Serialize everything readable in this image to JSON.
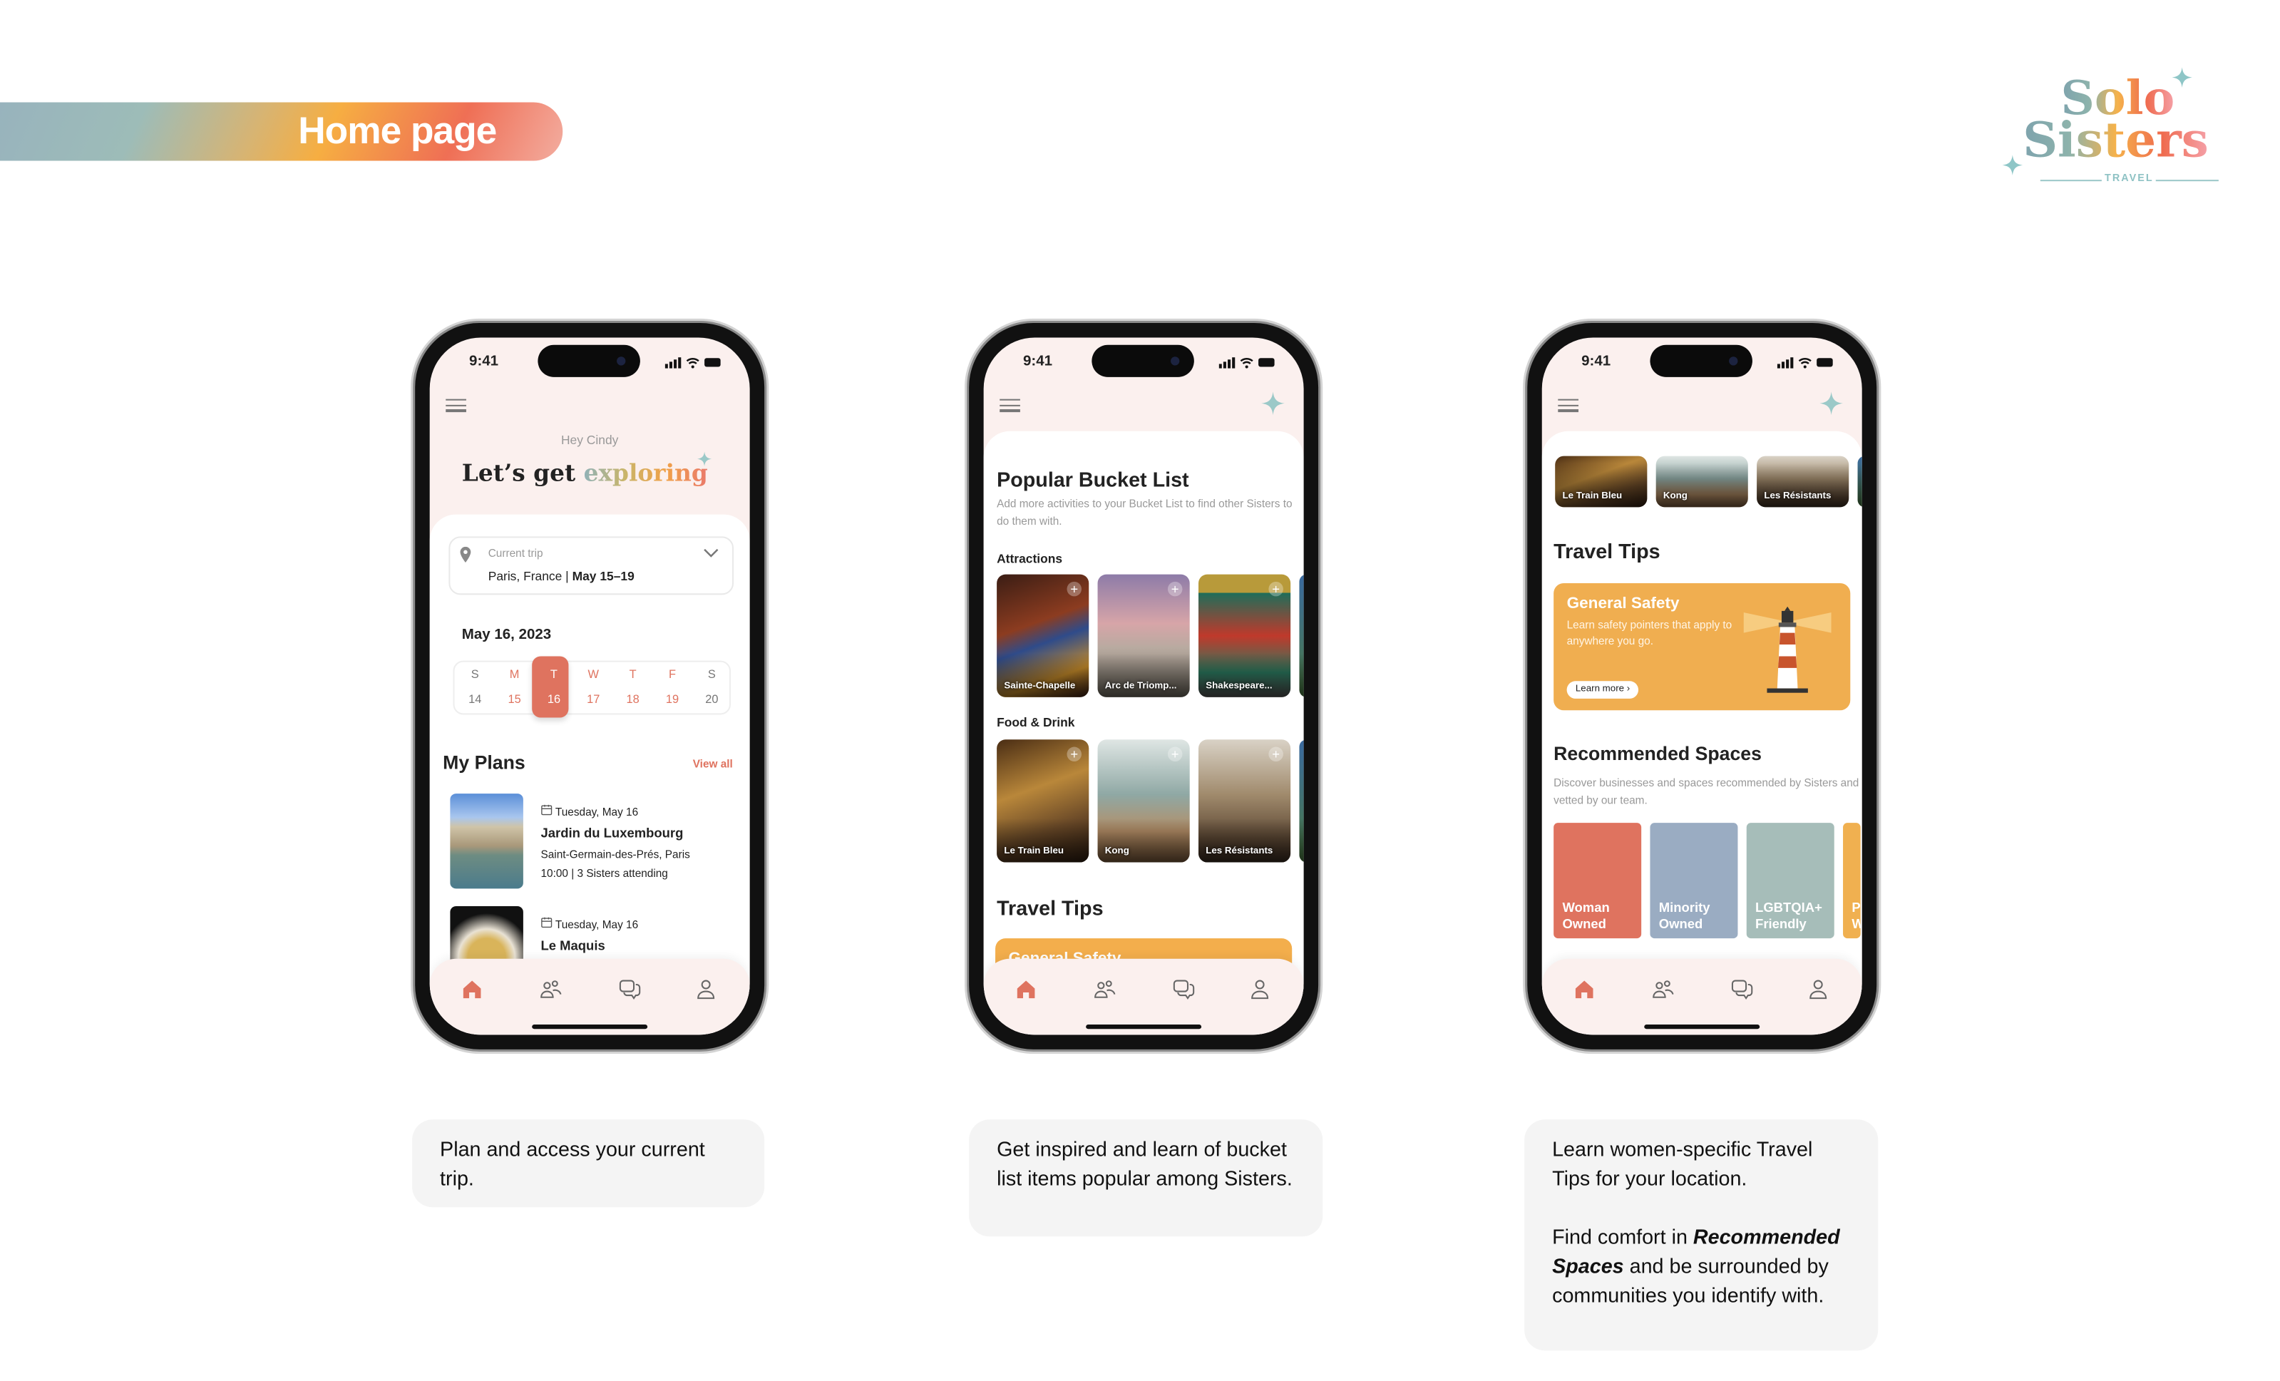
{
  "banner": {
    "title": "Home page"
  },
  "logo": {
    "line1": "Solo",
    "line2": "Sisters",
    "tagline": "TRAVEL"
  },
  "colors": {
    "accent": "#df735f",
    "tip_card": "#f3ae4c",
    "screen_tint": "#fbf0ee",
    "woman_owned": "#df735f",
    "minority_owned": "#9aacc2",
    "lgbtqia": "#a6bdb9",
    "fourth_tile": "#f0b050"
  },
  "status": {
    "time": "9:41",
    "icons": [
      "signal-icon",
      "wifi-icon",
      "battery-icon"
    ]
  },
  "nav": {
    "items": [
      {
        "icon": "home-icon",
        "active": true
      },
      {
        "icon": "community-icon"
      },
      {
        "icon": "chat-icon"
      },
      {
        "icon": "profile-icon"
      }
    ]
  },
  "home": {
    "greeting": "Hey Cindy",
    "headline_plain": "Let’s get",
    "headline_colored": "exploring",
    "trip": {
      "label": "Current trip",
      "location": "Paris, France |",
      "dates": "May 15–19"
    },
    "date_heading": "May 16, 2023",
    "week": [
      {
        "day": "S",
        "date": "14"
      },
      {
        "day": "M",
        "date": "15"
      },
      {
        "day": "T",
        "date": "16",
        "selected": true
      },
      {
        "day": "W",
        "date": "17"
      },
      {
        "day": "T",
        "date": "18"
      },
      {
        "day": "F",
        "date": "19"
      },
      {
        "day": "S",
        "date": "20"
      }
    ],
    "plans_title": "My Plans",
    "view_all": "View all",
    "plans": [
      {
        "date": "Tuesday, May 16",
        "name": "Jardin du Luxembourg",
        "area": "Saint-Germain-des-Prés, Paris",
        "meta": "10:00 | 3 Sisters attending"
      },
      {
        "date": "Tuesday, May 16",
        "name": "Le Maquis"
      }
    ]
  },
  "bucket": {
    "title": "Popular Bucket List",
    "subtitle": "Add more activities to your Bucket List to find other Sisters to do them with.",
    "attractions_label": "Attractions",
    "attractions": [
      "Sainte-Chapelle",
      "Arc de Triomp...",
      "Shakespeare..."
    ],
    "food_label": "Food & Drink",
    "food": [
      "Le Train Bleu",
      "Kong",
      "Les Résistants"
    ],
    "tips_title": "Travel Tips",
    "tip_peek": "General Safety"
  },
  "tips": {
    "food": [
      "Le Train Bleu",
      "Kong",
      "Les Résistants"
    ],
    "tips_title": "Travel Tips",
    "tip": {
      "title": "General Safety",
      "desc": "Learn safety pointers that apply to anywhere you go.",
      "cta": "Learn more ›"
    },
    "spaces_title": "Recommended Spaces",
    "spaces_desc": "Discover businesses and spaces recommended by Sisters and vetted by our team.",
    "spaces": [
      {
        "line1": "Woman",
        "line2": "Owned"
      },
      {
        "line1": "Minority",
        "line2": "Owned"
      },
      {
        "line1": "LGBTQIA+",
        "line2": "Friendly"
      },
      {
        "line1": "Pl",
        "line2": "W"
      }
    ]
  },
  "captions": {
    "home": "Plan and access your current trip.",
    "bucket": "Get inspired and learn of bucket list items popular among Sisters.",
    "tips_p1": "Learn women-specific Travel Tips for your location.",
    "tips_p2_a": "Find comfort in ",
    "tips_p2_em": "Recommended Spaces",
    "tips_p2_b": " and be surrounded by communities you identify with."
  }
}
